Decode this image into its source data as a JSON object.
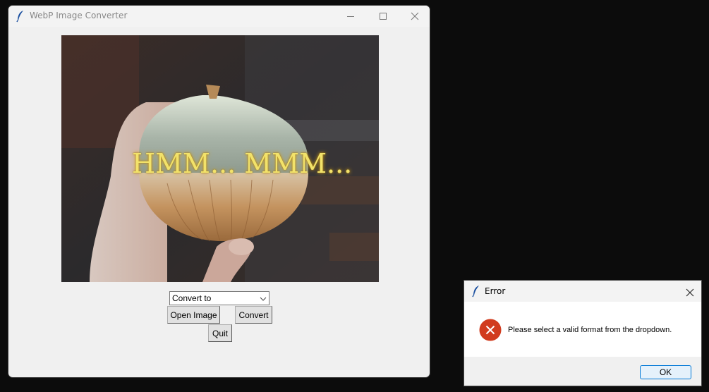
{
  "main_window": {
    "title": "WebP Image Converter",
    "app_icon": "feather-icon",
    "controls": {
      "minimize_icon": "minimize-icon",
      "maximize_icon": "maximize-icon",
      "close_icon": "close-icon"
    },
    "preview_image": {
      "overlay_text": "HMM... MMM..."
    },
    "format_dropdown": {
      "selected": "Convert to",
      "icon": "chevron-down-icon"
    },
    "buttons": {
      "open_image": "Open Image",
      "convert": "Convert",
      "quit": "Quit"
    }
  },
  "error_dialog": {
    "title": "Error",
    "app_icon": "feather-icon",
    "close_icon": "close-icon",
    "status_icon": "error-icon",
    "message": "Please select a valid format from the dropdown.",
    "ok_label": "OK",
    "colors": {
      "error_red": "#d13b1e",
      "ok_border": "#0078d7"
    }
  }
}
